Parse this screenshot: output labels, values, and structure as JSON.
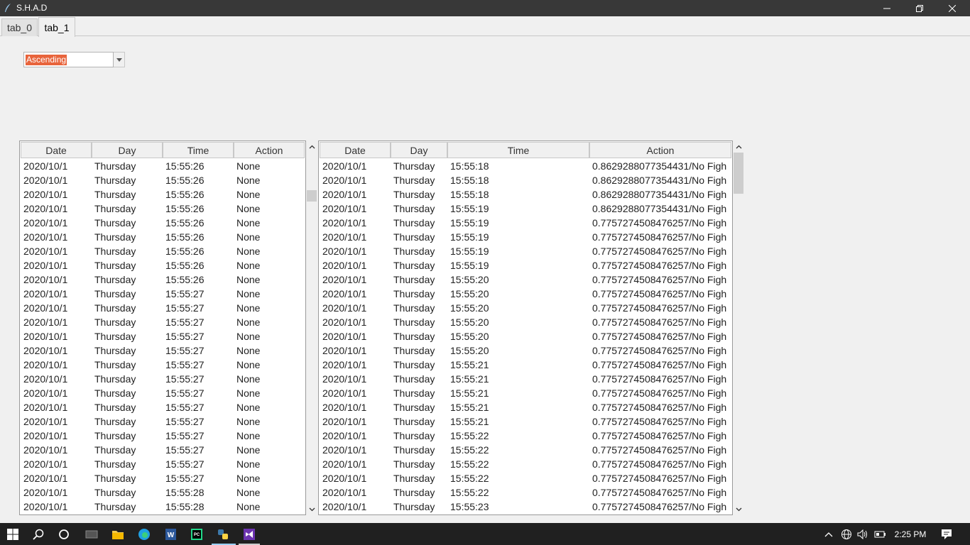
{
  "window": {
    "title": "S.H.A.D",
    "controls": {
      "minimize": "minimize",
      "maximize": "restore",
      "close": "close"
    }
  },
  "tabs": [
    {
      "label": "tab_0",
      "selected": false
    },
    {
      "label": "tab_1",
      "selected": true
    }
  ],
  "sort_combo": {
    "value": "Ascending"
  },
  "left_table": {
    "headers": [
      "Date",
      "Day",
      "Time",
      "Action"
    ],
    "rows": [
      [
        "2020/10/1",
        "Thursday",
        "15:55:26",
        "None"
      ],
      [
        "2020/10/1",
        "Thursday",
        "15:55:26",
        "None"
      ],
      [
        "2020/10/1",
        "Thursday",
        "15:55:26",
        "None"
      ],
      [
        "2020/10/1",
        "Thursday",
        "15:55:26",
        "None"
      ],
      [
        "2020/10/1",
        "Thursday",
        "15:55:26",
        "None"
      ],
      [
        "2020/10/1",
        "Thursday",
        "15:55:26",
        "None"
      ],
      [
        "2020/10/1",
        "Thursday",
        "15:55:26",
        "None"
      ],
      [
        "2020/10/1",
        "Thursday",
        "15:55:26",
        "None"
      ],
      [
        "2020/10/1",
        "Thursday",
        "15:55:26",
        "None"
      ],
      [
        "2020/10/1",
        "Thursday",
        "15:55:27",
        "None"
      ],
      [
        "2020/10/1",
        "Thursday",
        "15:55:27",
        "None"
      ],
      [
        "2020/10/1",
        "Thursday",
        "15:55:27",
        "None"
      ],
      [
        "2020/10/1",
        "Thursday",
        "15:55:27",
        "None"
      ],
      [
        "2020/10/1",
        "Thursday",
        "15:55:27",
        "None"
      ],
      [
        "2020/10/1",
        "Thursday",
        "15:55:27",
        "None"
      ],
      [
        "2020/10/1",
        "Thursday",
        "15:55:27",
        "None"
      ],
      [
        "2020/10/1",
        "Thursday",
        "15:55:27",
        "None"
      ],
      [
        "2020/10/1",
        "Thursday",
        "15:55:27",
        "None"
      ],
      [
        "2020/10/1",
        "Thursday",
        "15:55:27",
        "None"
      ],
      [
        "2020/10/1",
        "Thursday",
        "15:55:27",
        "None"
      ],
      [
        "2020/10/1",
        "Thursday",
        "15:55:27",
        "None"
      ],
      [
        "2020/10/1",
        "Thursday",
        "15:55:27",
        "None"
      ],
      [
        "2020/10/1",
        "Thursday",
        "15:55:27",
        "None"
      ],
      [
        "2020/10/1",
        "Thursday",
        "15:55:28",
        "None"
      ],
      [
        "2020/10/1",
        "Thursday",
        "15:55:28",
        "None"
      ]
    ]
  },
  "right_table": {
    "headers": [
      "Date",
      "Day",
      "Time",
      "Action"
    ],
    "rows": [
      [
        "2020/10/1",
        "Thursday",
        "15:55:18",
        "0.8629288077354431/No Figh"
      ],
      [
        "2020/10/1",
        "Thursday",
        "15:55:18",
        "0.8629288077354431/No Figh"
      ],
      [
        "2020/10/1",
        "Thursday",
        "15:55:18",
        "0.8629288077354431/No Figh"
      ],
      [
        "2020/10/1",
        "Thursday",
        "15:55:19",
        "0.8629288077354431/No Figh"
      ],
      [
        "2020/10/1",
        "Thursday",
        "15:55:19",
        "0.7757274508476257/No Figh"
      ],
      [
        "2020/10/1",
        "Thursday",
        "15:55:19",
        "0.7757274508476257/No Figh"
      ],
      [
        "2020/10/1",
        "Thursday",
        "15:55:19",
        "0.7757274508476257/No Figh"
      ],
      [
        "2020/10/1",
        "Thursday",
        "15:55:19",
        "0.7757274508476257/No Figh"
      ],
      [
        "2020/10/1",
        "Thursday",
        "15:55:20",
        "0.7757274508476257/No Figh"
      ],
      [
        "2020/10/1",
        "Thursday",
        "15:55:20",
        "0.7757274508476257/No Figh"
      ],
      [
        "2020/10/1",
        "Thursday",
        "15:55:20",
        "0.7757274508476257/No Figh"
      ],
      [
        "2020/10/1",
        "Thursday",
        "15:55:20",
        "0.7757274508476257/No Figh"
      ],
      [
        "2020/10/1",
        "Thursday",
        "15:55:20",
        "0.7757274508476257/No Figh"
      ],
      [
        "2020/10/1",
        "Thursday",
        "15:55:20",
        "0.7757274508476257/No Figh"
      ],
      [
        "2020/10/1",
        "Thursday",
        "15:55:21",
        "0.7757274508476257/No Figh"
      ],
      [
        "2020/10/1",
        "Thursday",
        "15:55:21",
        "0.7757274508476257/No Figh"
      ],
      [
        "2020/10/1",
        "Thursday",
        "15:55:21",
        "0.7757274508476257/No Figh"
      ],
      [
        "2020/10/1",
        "Thursday",
        "15:55:21",
        "0.7757274508476257/No Figh"
      ],
      [
        "2020/10/1",
        "Thursday",
        "15:55:21",
        "0.7757274508476257/No Figh"
      ],
      [
        "2020/10/1",
        "Thursday",
        "15:55:22",
        "0.7757274508476257/No Figh"
      ],
      [
        "2020/10/1",
        "Thursday",
        "15:55:22",
        "0.7757274508476257/No Figh"
      ],
      [
        "2020/10/1",
        "Thursday",
        "15:55:22",
        "0.7757274508476257/No Figh"
      ],
      [
        "2020/10/1",
        "Thursday",
        "15:55:22",
        "0.7757274508476257/No Figh"
      ],
      [
        "2020/10/1",
        "Thursday",
        "15:55:22",
        "0.7757274508476257/No Figh"
      ],
      [
        "2020/10/1",
        "Thursday",
        "15:55:23",
        "0.7757274508476257/No Figh"
      ]
    ]
  },
  "taskbar": {
    "apps": [
      "windows-start",
      "search",
      "cortana",
      "task-view",
      "file-explorer",
      "edge",
      "word",
      "pycharm",
      "python",
      "visual-studio"
    ],
    "clock": "2:25 PM",
    "tray_icons": [
      "chevron-up",
      "network",
      "volume",
      "battery",
      "notifications"
    ]
  }
}
